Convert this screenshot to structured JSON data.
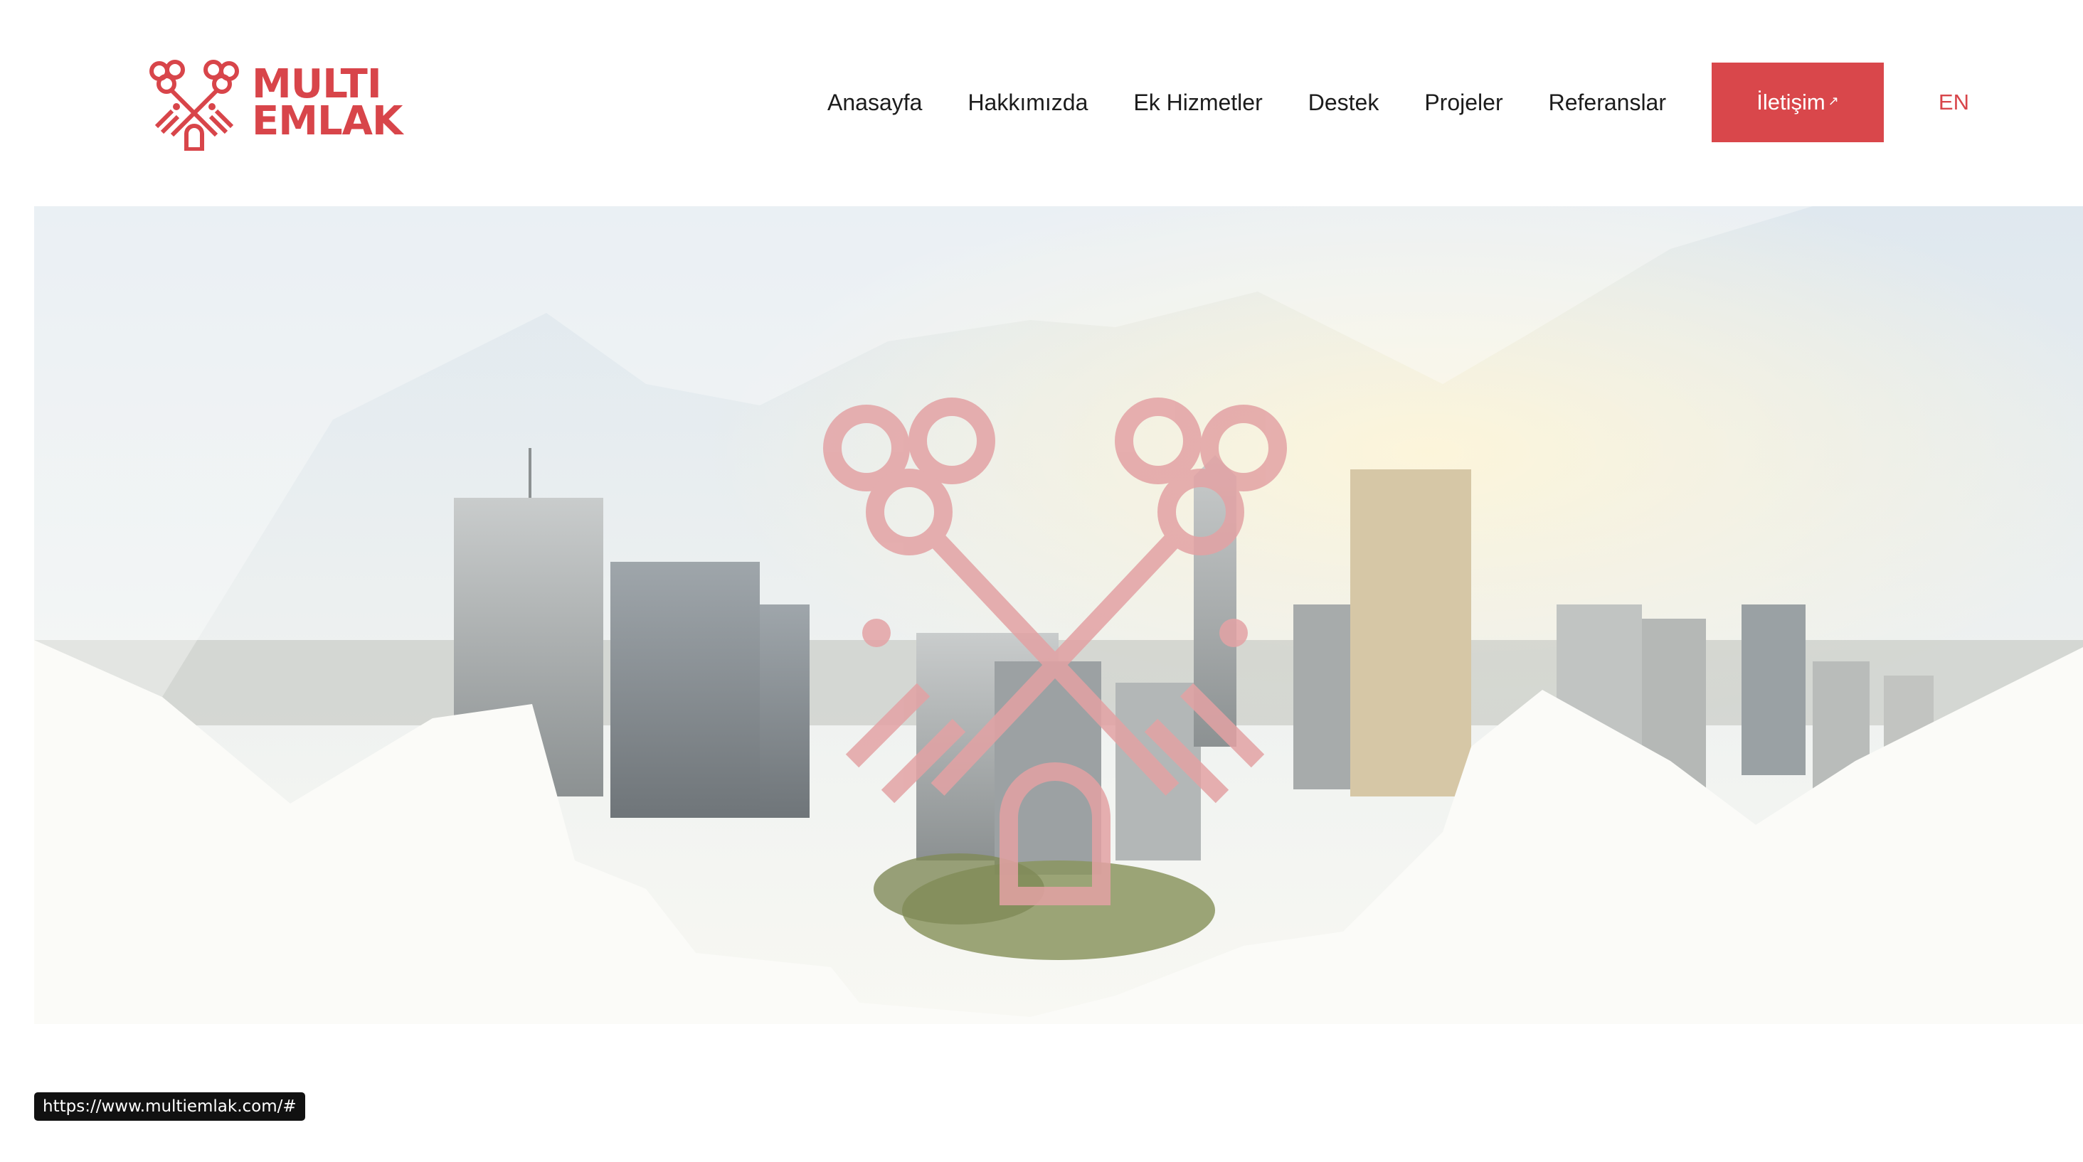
{
  "brand": {
    "line1": "MULTI",
    "line2": "EMLAK",
    "color": "#d8454a"
  },
  "nav": {
    "items": [
      {
        "label": "Anasayfa"
      },
      {
        "label": "Hakkımızda"
      },
      {
        "label": "Ek Hizmetler"
      },
      {
        "label": "Destek"
      },
      {
        "label": "Projeler"
      },
      {
        "label": "Referanslar"
      }
    ],
    "contact": {
      "label": "İletişim",
      "icon": "external-link-icon",
      "color": "#d9474b"
    },
    "lang": "EN"
  },
  "hero": {
    "image": "handshake-city-skyline",
    "watermark": "crossed-keys-logo"
  },
  "status": {
    "url": "https://www.multiemlak.com/#"
  }
}
